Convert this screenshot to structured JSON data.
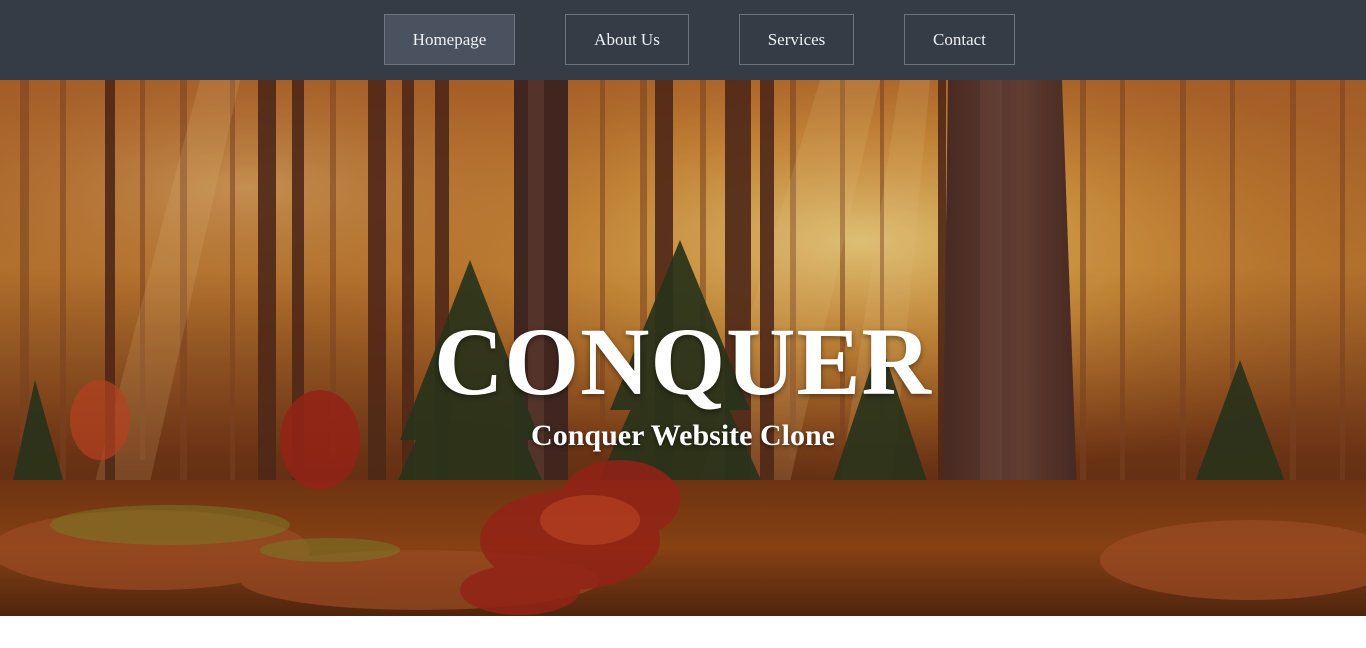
{
  "nav": {
    "items": [
      {
        "label": "Homepage",
        "active": true
      },
      {
        "label": "About Us",
        "active": false
      },
      {
        "label": "Services",
        "active": false
      },
      {
        "label": "Contact",
        "active": false
      }
    ]
  },
  "hero": {
    "title": "CONQUER",
    "subtitle": "Conquer Website Clone",
    "image": "autumn-forest-background"
  },
  "colors": {
    "navbar_bg": "#353c46",
    "nav_border": "#6c7480",
    "nav_active_bg": "#4a5260",
    "hero_text": "#ffffff"
  }
}
